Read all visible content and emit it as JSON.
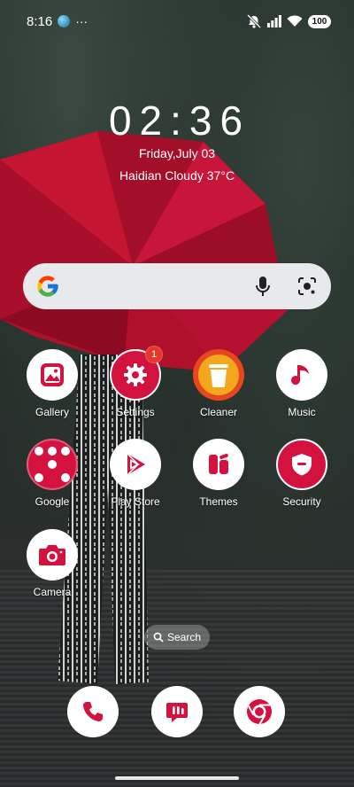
{
  "status_bar": {
    "time": "8:16",
    "overflow": "···",
    "battery": "100",
    "icons": [
      "globe-icon",
      "mute-icon",
      "signal-icon",
      "wifi-icon",
      "battery-icon"
    ]
  },
  "clock": {
    "time": "02:36",
    "date": "Friday,July 03",
    "weather": "Haidian Cloudy 37°C"
  },
  "search_widget": {
    "icons": [
      "google-logo-icon",
      "microphone-icon",
      "lens-icon"
    ]
  },
  "apps": [
    {
      "label": "Gallery",
      "icon": "gallery-icon"
    },
    {
      "label": "Settings",
      "icon": "gear-icon",
      "badge": "1"
    },
    {
      "label": "Cleaner",
      "icon": "trash-icon"
    },
    {
      "label": "Music",
      "icon": "music-note-icon"
    },
    {
      "label": "Google",
      "icon": "folder-icon"
    },
    {
      "label": "Play Store",
      "icon": "play-store-icon"
    },
    {
      "label": "Themes",
      "icon": "themes-icon"
    },
    {
      "label": "Security",
      "icon": "shield-icon"
    },
    {
      "label": "Camera",
      "icon": "camera-icon"
    }
  ],
  "home_search": {
    "label": "Search"
  },
  "dock": [
    {
      "icon": "phone-icon"
    },
    {
      "icon": "messages-icon"
    },
    {
      "icon": "chrome-icon"
    }
  ],
  "colors": {
    "accent": "#d4123f",
    "badge": "#e5382d",
    "cleaner": "#f3a71c"
  }
}
